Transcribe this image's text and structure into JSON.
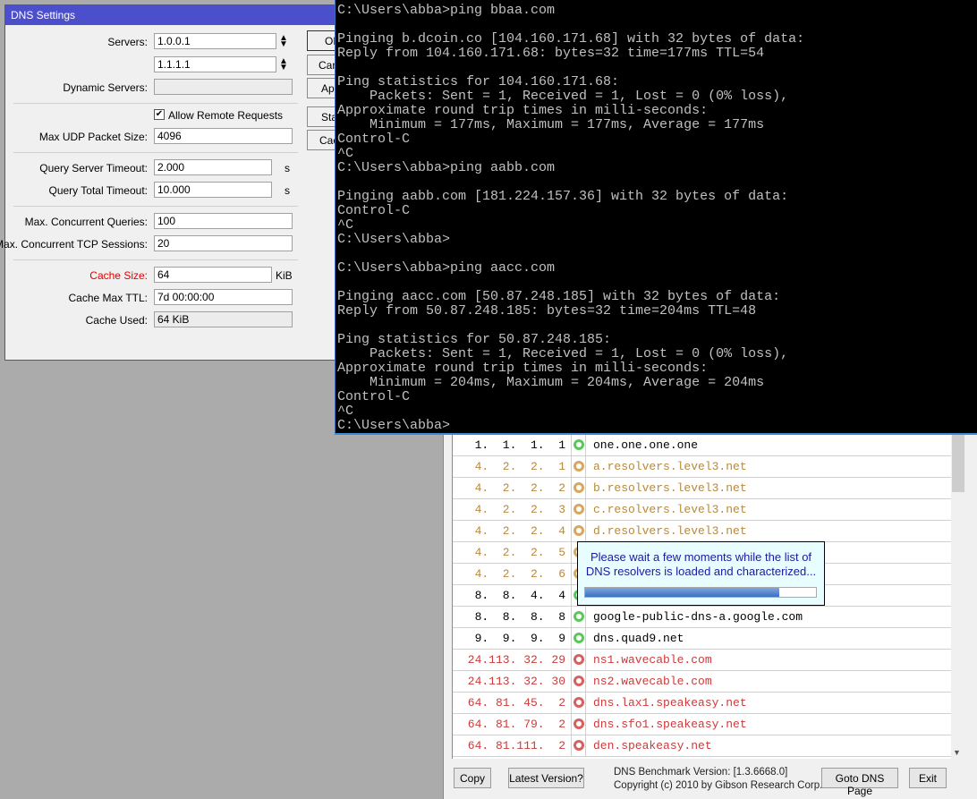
{
  "dns_settings": {
    "title": "DNS Settings",
    "servers_label": "Servers:",
    "server1": "1.0.0.1",
    "server2": "1.1.1.1",
    "dynamic_servers_label": "Dynamic Servers:",
    "dynamic_servers": "",
    "allow_remote_label": "Allow Remote Requests",
    "allow_remote": true,
    "max_udp_label": "Max UDP Packet Size:",
    "max_udp": "4096",
    "qst_label": "Query Server Timeout:",
    "qst": "2.000",
    "qtt_label": "Query Total Timeout:",
    "qtt": "10.000",
    "sec_unit": "s",
    "mcq_label": "Max. Concurrent Queries:",
    "mcq": "100",
    "mcts_label": "Max. Concurrent TCP Sessions:",
    "mcts": "20",
    "cache_size_label": "Cache Size:",
    "cache_size": "64",
    "kib_unit": "KiB",
    "cache_ttl_label": "Cache Max TTL:",
    "cache_ttl": "7d 00:00:00",
    "cache_used_label": "Cache Used:",
    "cache_used": "64 KiB",
    "buttons": [
      "OK",
      "Cancel",
      "Apply",
      "Static",
      "Cache"
    ]
  },
  "terminal": {
    "lines": [
      "C:\\Users\\abba>ping bbaa.com",
      "",
      "Pinging b.dcoin.co [104.160.171.68] with 32 bytes of data:",
      "Reply from 104.160.171.68: bytes=32 time=177ms TTL=54",
      "",
      "Ping statistics for 104.160.171.68:",
      "    Packets: Sent = 1, Received = 1, Lost = 0 (0% loss),",
      "Approximate round trip times in milli-seconds:",
      "    Minimum = 177ms, Maximum = 177ms, Average = 177ms",
      "Control-C",
      "^C",
      "C:\\Users\\abba>ping aabb.com",
      "",
      "Pinging aabb.com [181.224.157.36] with 32 bytes of data:",
      "Control-C",
      "^C",
      "C:\\Users\\abba>",
      "",
      "C:\\Users\\abba>ping aacc.com",
      "",
      "Pinging aacc.com [50.87.248.185] with 32 bytes of data:",
      "Reply from 50.87.248.185: bytes=32 time=204ms TTL=48",
      "",
      "Ping statistics for 50.87.248.185:",
      "    Packets: Sent = 1, Received = 1, Lost = 0 (0% loss),",
      "Approximate round trip times in milli-seconds:",
      "    Minimum = 204ms, Maximum = 204ms, Average = 204ms",
      "Control-C",
      "^C",
      "C:\\Users\\abba>"
    ]
  },
  "benchmark": {
    "colors": {
      "green": "#5ac85a",
      "orange": "#d9a860",
      "red": "#d86060",
      "text_green": "#000000",
      "text_orange": "#b8893a",
      "text_red": "#cc3a3a"
    },
    "rows": [
      {
        "ip": " 1.  1.  1.  1",
        "name": "one.one.one.one",
        "status": "green"
      },
      {
        "ip": " 4.  2.  2.  1",
        "name": "a.resolvers.level3.net",
        "status": "orange"
      },
      {
        "ip": " 4.  2.  2.  2",
        "name": "b.resolvers.level3.net",
        "status": "orange"
      },
      {
        "ip": " 4.  2.  2.  3",
        "name": "c.resolvers.level3.net",
        "status": "orange"
      },
      {
        "ip": " 4.  2.  2.  4",
        "name": "d.resolvers.level3.net",
        "status": "orange"
      },
      {
        "ip": " 4.  2.  2.  5",
        "name": "",
        "status": "orange"
      },
      {
        "ip": " 4.  2.  2.  6",
        "name": "",
        "status": "orange"
      },
      {
        "ip": " 8.  8.  4.  4",
        "name": "",
        "status": "green"
      },
      {
        "ip": " 8.  8.  8.  8",
        "name": "google-public-dns-a.google.com",
        "status": "green"
      },
      {
        "ip": " 9.  9.  9.  9",
        "name": "dns.quad9.net",
        "status": "green"
      },
      {
        "ip": "24.113. 32. 29",
        "name": "ns1.wavecable.com",
        "status": "red"
      },
      {
        "ip": "24.113. 32. 30",
        "name": "ns2.wavecable.com",
        "status": "red"
      },
      {
        "ip": "64. 81. 45.  2",
        "name": "dns.lax1.speakeasy.net",
        "status": "red"
      },
      {
        "ip": "64. 81. 79.  2",
        "name": "dns.sfo1.speakeasy.net",
        "status": "red"
      },
      {
        "ip": "64. 81.111.  2",
        "name": "den.speakeasy.net",
        "status": "red"
      }
    ],
    "copy": "Copy",
    "latest": "Latest Version?",
    "version": "DNS Benchmark Version: [1.3.6668.0]",
    "copyright": "Copyright (c) 2010 by Gibson Research Corp.",
    "goto": "Goto DNS Page",
    "exit": "Exit",
    "popup": {
      "line1": "Please wait a few moments while the list of",
      "line2": "DNS resolvers is loaded and characterized...",
      "progress_percent": 84
    }
  }
}
